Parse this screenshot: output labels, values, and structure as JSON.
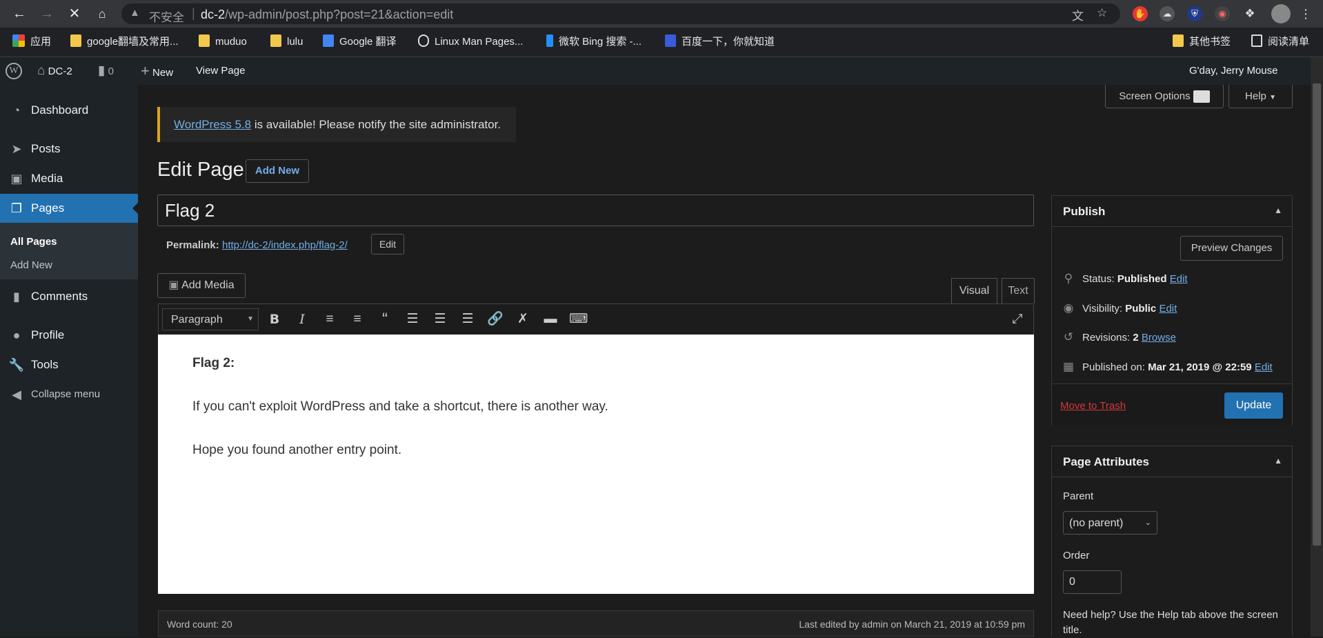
{
  "browser": {
    "insecure_label": "不安全",
    "url_host": "dc-2",
    "url_path": "/wp-admin/post.php?post=21&action=edit",
    "bookmarks": [
      {
        "label": "应用",
        "icon": "apps-grid-icon"
      },
      {
        "label": "google翻墙及常用...",
        "icon": "folder-icon"
      },
      {
        "label": "muduo",
        "icon": "folder-icon"
      },
      {
        "label": "lulu",
        "icon": "folder-icon"
      },
      {
        "label": "Google 翻译",
        "icon": "google-translate-icon"
      },
      {
        "label": "Linux Man Pages...",
        "icon": "linux-icon"
      },
      {
        "label": "微软 Bing 搜索 -...",
        "icon": "bing-icon"
      },
      {
        "label": "百度一下，你就知道",
        "icon": "baidu-icon"
      }
    ],
    "other_bookmarks": "其他书签",
    "reading_list": "阅读清单"
  },
  "adminbar": {
    "site_name": "DC-2",
    "comments_count": "0",
    "new_label": "New",
    "view_page": "View Page",
    "greeting": "G'day, Jerry Mouse"
  },
  "sidebar": {
    "items": [
      {
        "label": "Dashboard",
        "icon": "dashboard-icon"
      },
      {
        "label": "Posts",
        "icon": "pin-icon"
      },
      {
        "label": "Media",
        "icon": "media-icon"
      },
      {
        "label": "Pages",
        "icon": "pages-icon"
      },
      {
        "label": "Comments",
        "icon": "comment-icon"
      },
      {
        "label": "Profile",
        "icon": "user-icon"
      },
      {
        "label": "Tools",
        "icon": "wrench-icon"
      },
      {
        "label": "Collapse menu",
        "icon": "collapse-icon"
      }
    ],
    "submenu": [
      "All Pages",
      "Add New"
    ]
  },
  "screen_options": "Screen Options",
  "help": "Help",
  "notice": {
    "link": "WordPress 5.8",
    "text": " is available! Please notify the site administrator."
  },
  "heading": "Edit Page",
  "add_new": "Add New",
  "title_value": "Flag 2",
  "permalink": {
    "label": "Permalink:",
    "url": "http://dc-2/index.php/flag-2/",
    "edit": "Edit"
  },
  "add_media": "Add Media",
  "editor_tabs": [
    "Visual",
    "Text"
  ],
  "format_select": "Paragraph",
  "content": {
    "heading": "Flag 2:",
    "p1": "If you can't exploit WordPress and take a shortcut, there is another way.",
    "p2": "Hope you found another entry point."
  },
  "status": {
    "word_count": "Word count: 20",
    "last_edited": "Last edited by admin on March 21, 2019 at 10:59 pm"
  },
  "publish": {
    "title": "Publish",
    "preview": "Preview Changes",
    "status_label": "Status:",
    "status_value": "Published",
    "visibility_label": "Visibility:",
    "visibility_value": "Public",
    "revisions_label": "Revisions:",
    "revisions_value": "2",
    "browse": "Browse",
    "published_label": "Published on:",
    "published_value": "Mar 21, 2019 @ 22:59",
    "edit": "Edit",
    "trash": "Move to Trash",
    "update": "Update"
  },
  "attributes": {
    "title": "Page Attributes",
    "parent_label": "Parent",
    "parent_value": "(no parent)",
    "order_label": "Order",
    "order_value": "0",
    "help_text": "Need help? Use the Help tab above the screen title."
  },
  "colors": {
    "accent": "#2271b1",
    "link": "#72aee6",
    "notice_border": "#dba617",
    "trash": "#d63638"
  }
}
